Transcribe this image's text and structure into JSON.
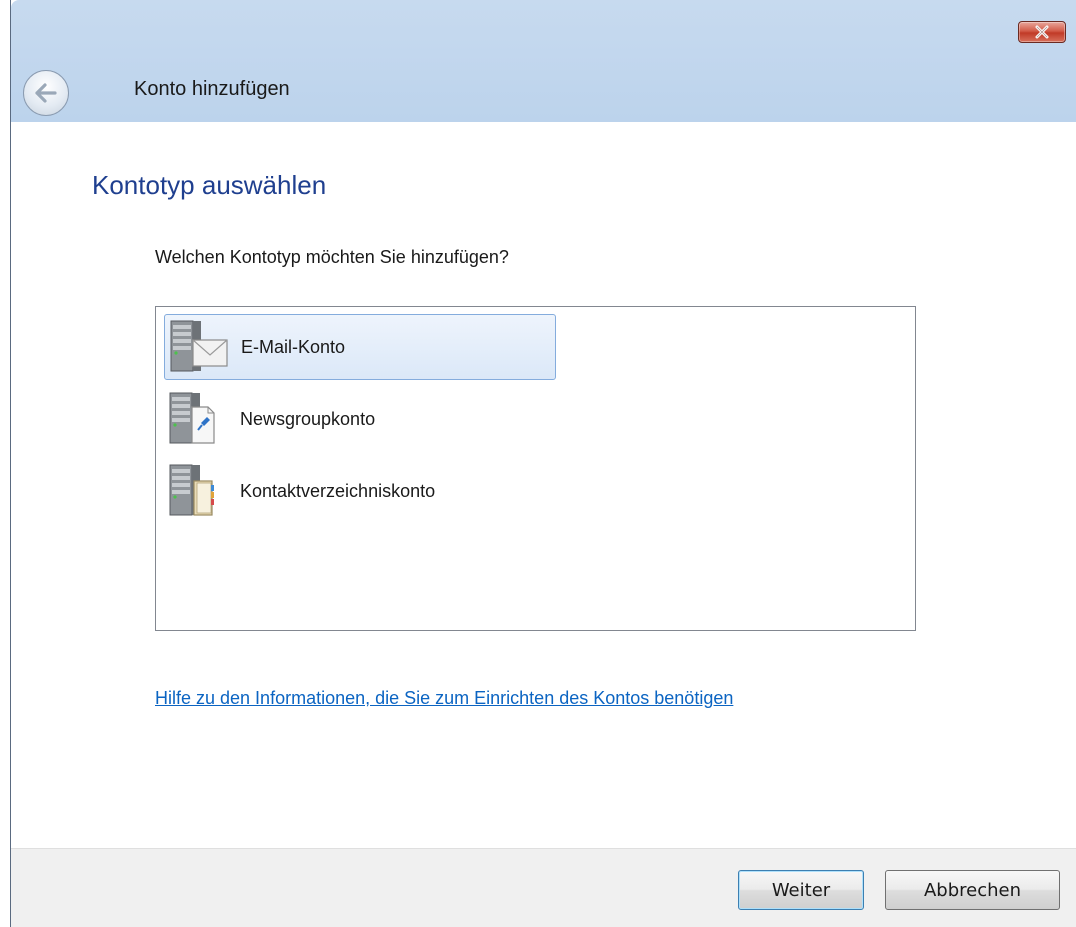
{
  "window": {
    "title": "Konto hinzufügen"
  },
  "page": {
    "heading": "Kontotyp auswählen",
    "question": "Welchen Kontotyp möchten Sie hinzufügen?"
  },
  "account_types": [
    {
      "label": "E-Mail-Konto",
      "icon": "email-server-icon",
      "selected": true
    },
    {
      "label": "Newsgroupkonto",
      "icon": "newsgroup-server-icon",
      "selected": false
    },
    {
      "label": "Kontaktverzeichniskonto",
      "icon": "directory-server-icon",
      "selected": false
    }
  ],
  "help_link": "Hilfe zu den Informationen, die Sie zum Einrichten des Kontos benötigen",
  "buttons": {
    "next": "Weiter",
    "cancel": "Abbrechen"
  },
  "colors": {
    "heading": "#1f3f8f",
    "link": "#0b64c2",
    "selection_border": "#84acdd",
    "close_button": "#c13a27"
  }
}
